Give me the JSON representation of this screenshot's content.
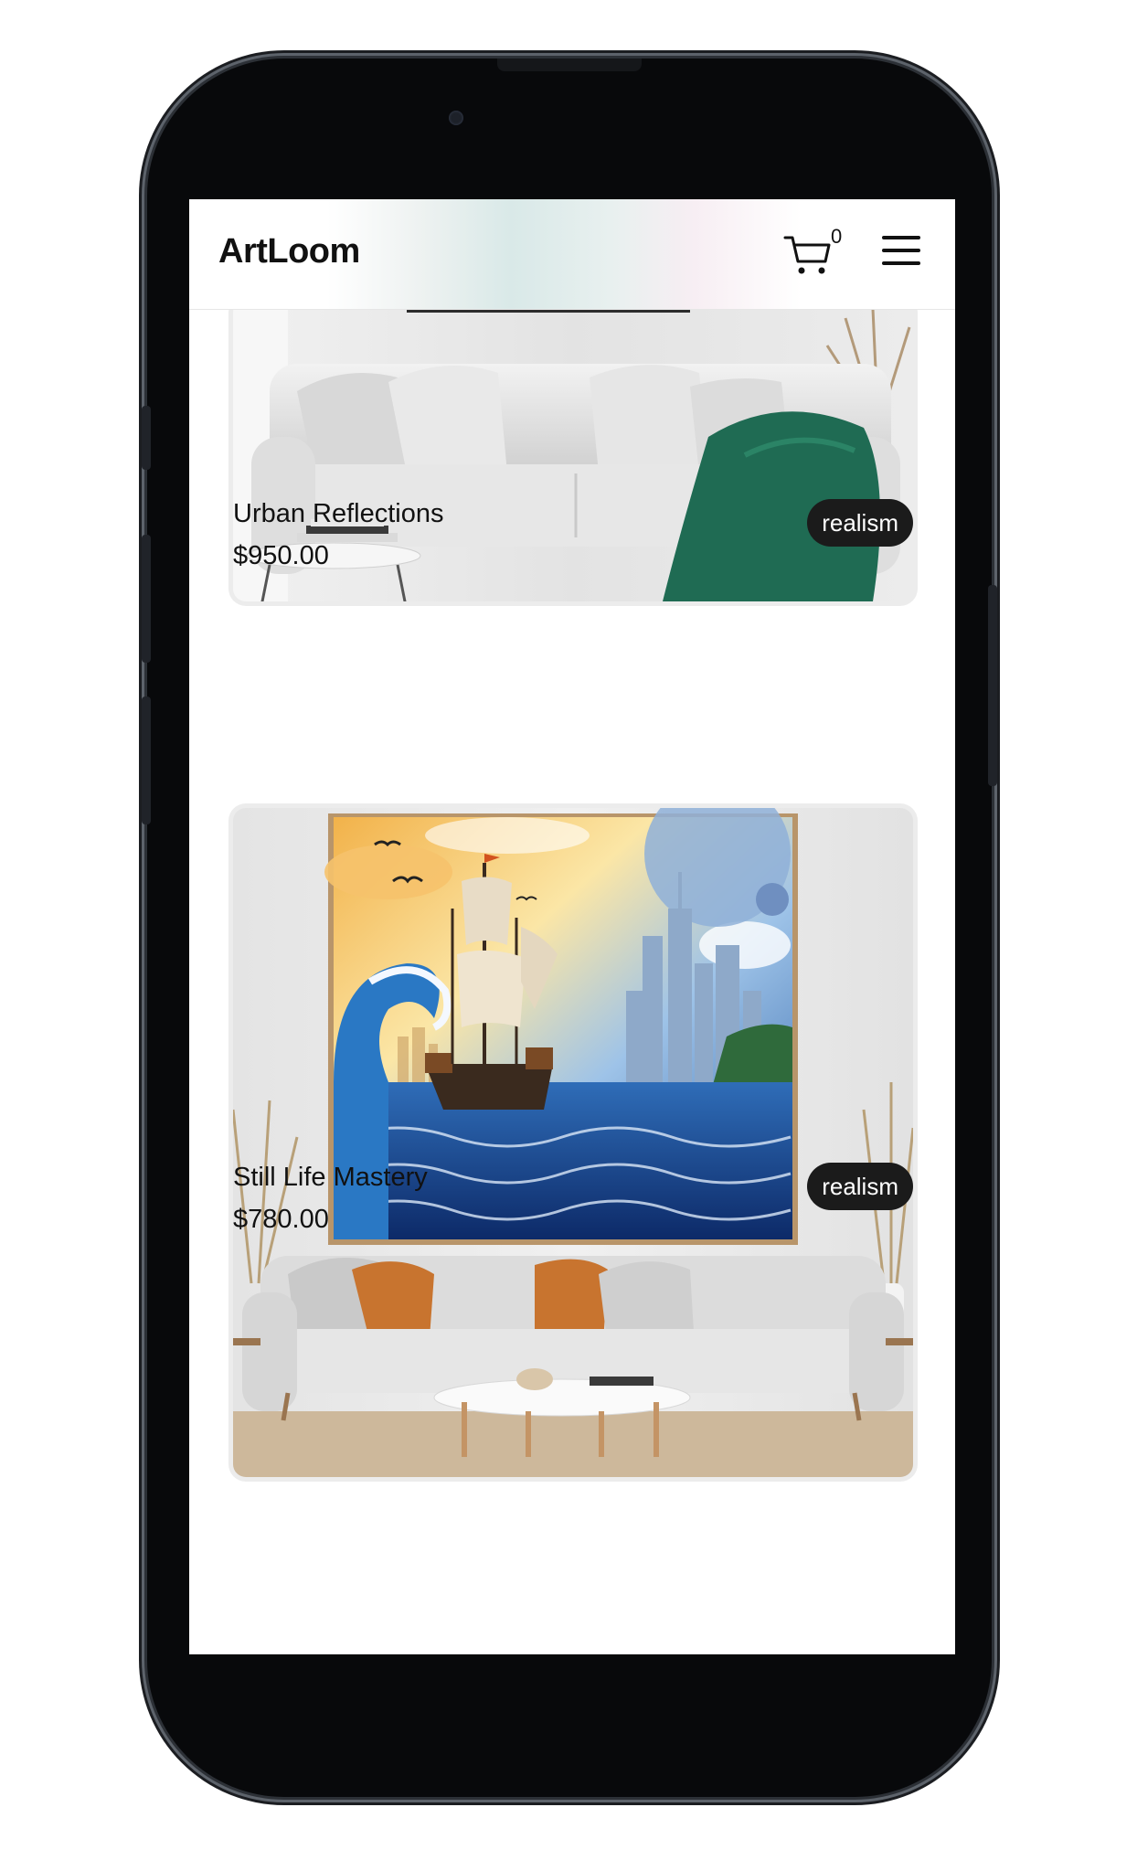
{
  "app": {
    "brand": "ArtLoom",
    "cart_count": "0"
  },
  "icons": {
    "cart": "shopping-cart-icon",
    "menu": "hamburger-menu-icon"
  },
  "colors": {
    "tag_background": "#1b1b1b",
    "tag_text": "#ffffff",
    "text": "#111111"
  },
  "artworks": [
    {
      "title": "Urban Reflections",
      "price": "$950.00",
      "tag": "realism"
    },
    {
      "title": "Still Life Mastery",
      "price": "$780.00",
      "tag": "realism"
    }
  ]
}
